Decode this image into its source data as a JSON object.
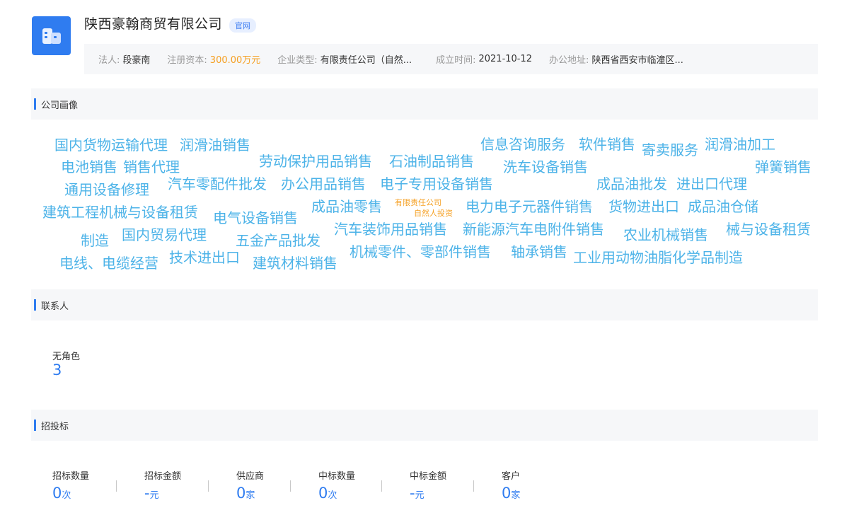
{
  "company": {
    "name": "陕西豪翰商贸有限公司",
    "official_tag": "官网"
  },
  "info": [
    {
      "label": "法人:",
      "value": "段豪南",
      "highlight": false
    },
    {
      "label": "注册资本:",
      "value": "300.00万元",
      "highlight": true
    },
    {
      "label": "企业类型:",
      "value": "有限责任公司（自然...",
      "highlight": false
    },
    {
      "label": "成立时间:",
      "value": "2021-10-12",
      "highlight": false
    },
    {
      "label": "办公地址:",
      "value": "陕西省西安市临潼区...",
      "highlight": false
    }
  ],
  "sections": {
    "portrait": "公司画像",
    "contacts": "联系人",
    "tender": "招投标"
  },
  "cloud_words": [
    "国内货物运输代理",
    "润滑油销售",
    "信息咨询服务",
    "软件销售",
    "寄卖服务",
    "润滑油加工",
    "电池销售",
    "销售代理",
    "劳动保护用品销售",
    "石油制品销售",
    "洗车设备销售",
    "弹簧销售",
    "通用设备修理",
    "汽车零配件批发",
    "办公用品销售",
    "电子专用设备销售",
    "成品油批发",
    "进出口代理",
    "建筑工程机械与设备租赁",
    "电气设备销售",
    "成品油零售",
    "有限责任公司",
    "自然人投资",
    "电力电子元器件销售",
    "货物进出口",
    "成品油仓储",
    "制造",
    "国内贸易代理",
    "五金产品批发",
    "汽车装饰用品销售",
    "新能源汽车电附件销售",
    "农业机械销售",
    "械与设备租赁",
    "电线、电缆经营",
    "技术进出口",
    "建筑材料销售",
    "机械零件、零部件销售",
    "轴承销售",
    "工业用动物油脂化学品制造"
  ],
  "contacts": {
    "label": "无角色",
    "count": "3"
  },
  "tender_stats": [
    {
      "label": "招标数量",
      "value": "0",
      "unit": "次"
    },
    {
      "label": "招标金额",
      "value": "-",
      "unit": "元"
    },
    {
      "label": "供应商",
      "value": "0",
      "unit": "家"
    },
    {
      "label": "中标数量",
      "value": "0",
      "unit": "次"
    },
    {
      "label": "中标金额",
      "value": "-",
      "unit": "元"
    },
    {
      "label": "客户",
      "value": "0",
      "unit": "家"
    }
  ],
  "colors": {
    "accent": "#2f7cf0",
    "cloud": "#4db3e8",
    "highlight": "#f5a023"
  }
}
